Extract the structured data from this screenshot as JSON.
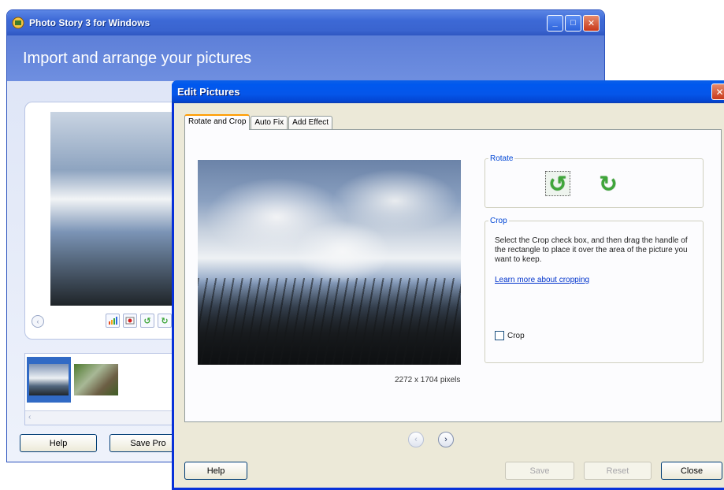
{
  "bg_window": {
    "title": "Photo Story 3 for Windows",
    "header": "Import and arrange your pictures",
    "buttons": {
      "help": "Help",
      "save_project": "Save Pro"
    },
    "nav_prev": "‹"
  },
  "dialog": {
    "title": "Edit Pictures",
    "close_glyph": "✕",
    "tabs": [
      {
        "label": "Rotate and Crop",
        "active": true
      },
      {
        "label": "Auto Fix",
        "active": false
      },
      {
        "label": "Add Effect",
        "active": false
      }
    ],
    "image_dimensions": "2272 x 1704 pixels",
    "rotate": {
      "legend": "Rotate",
      "counterclockwise_glyph": "↺",
      "clockwise_glyph": "↻"
    },
    "crop": {
      "legend": "Crop",
      "description": "Select the Crop check box, and then drag the handle of the rectangle to place it over the area of the picture you want to keep.",
      "learn_more": "Learn more about cropping",
      "checkbox_label": "Crop",
      "checked": false
    },
    "nav": {
      "prev": "‹",
      "next": "›"
    },
    "buttons": {
      "help": "Help",
      "save": "Save",
      "reset": "Reset",
      "close": "Close"
    }
  },
  "colors": {
    "dialog_titlebar": "#0058ee",
    "group_legend": "#0046d5",
    "link": "#0033cc",
    "rotate_icon": "#3fa63a"
  }
}
